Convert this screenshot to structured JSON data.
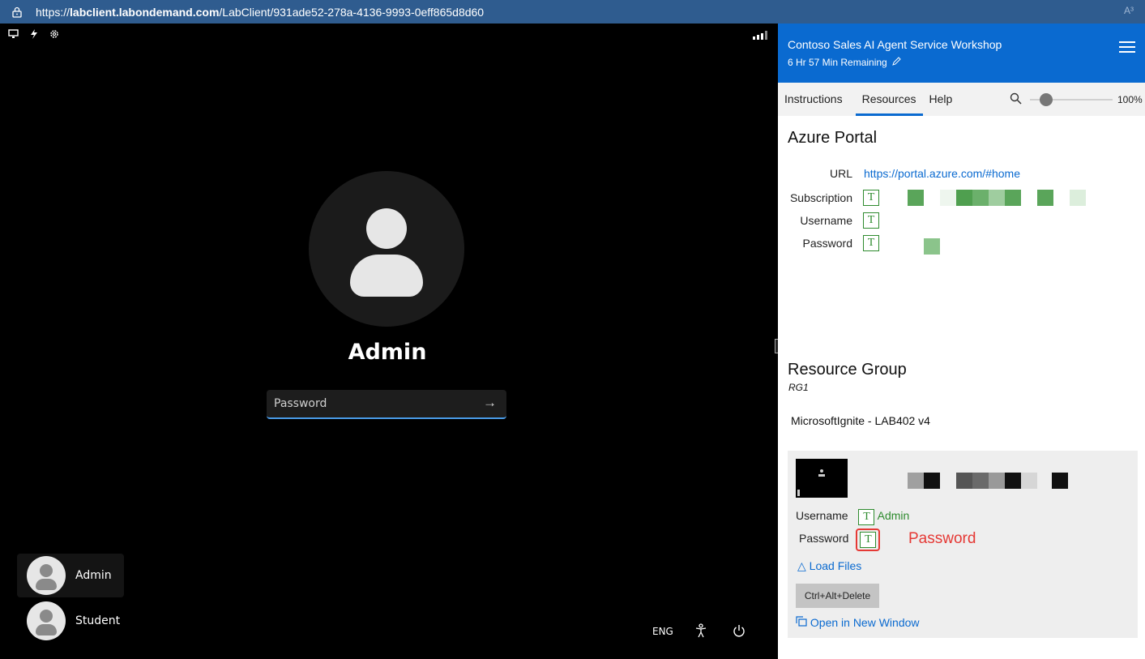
{
  "browser": {
    "url_scheme": "https://",
    "url_host": "labclient.labondemand.com",
    "url_path": "/LabClient/931ade52-278a-4136-9993-0eff865d8d60",
    "reader_icon": "A³"
  },
  "vm": {
    "user_name": "Admin",
    "password_placeholder": "Password",
    "users": [
      {
        "name": "Admin"
      },
      {
        "name": "Student"
      }
    ],
    "language": "ENG"
  },
  "panel": {
    "title": "Contoso Sales AI Agent Service Workshop",
    "remaining": "6 Hr 57 Min Remaining",
    "tabs": [
      {
        "label": "Instructions",
        "active": false
      },
      {
        "label": "Resources",
        "active": true
      },
      {
        "label": "Help",
        "active": false
      }
    ],
    "zoom": "100%",
    "zoom_level": 0.2,
    "azure": {
      "heading": "Azure Portal",
      "url_label": "URL",
      "url_value": "https://portal.azure.com/#home",
      "subscription_label": "Subscription",
      "username_label": "Username",
      "password_label": "Password"
    },
    "resource_group": {
      "heading": "Resource Group",
      "name": "RG1"
    },
    "lab_name": "MicrosoftIgnite - LAB402 v4",
    "vm_card": {
      "username_label": "Username",
      "username_value": "Admin",
      "password_label": "Password",
      "password_annotation": "Password",
      "load_files": "Load Files",
      "cad_button": "Ctrl+Alt+Delete",
      "open_window": "Open in New Window"
    },
    "type_icon": "T"
  }
}
